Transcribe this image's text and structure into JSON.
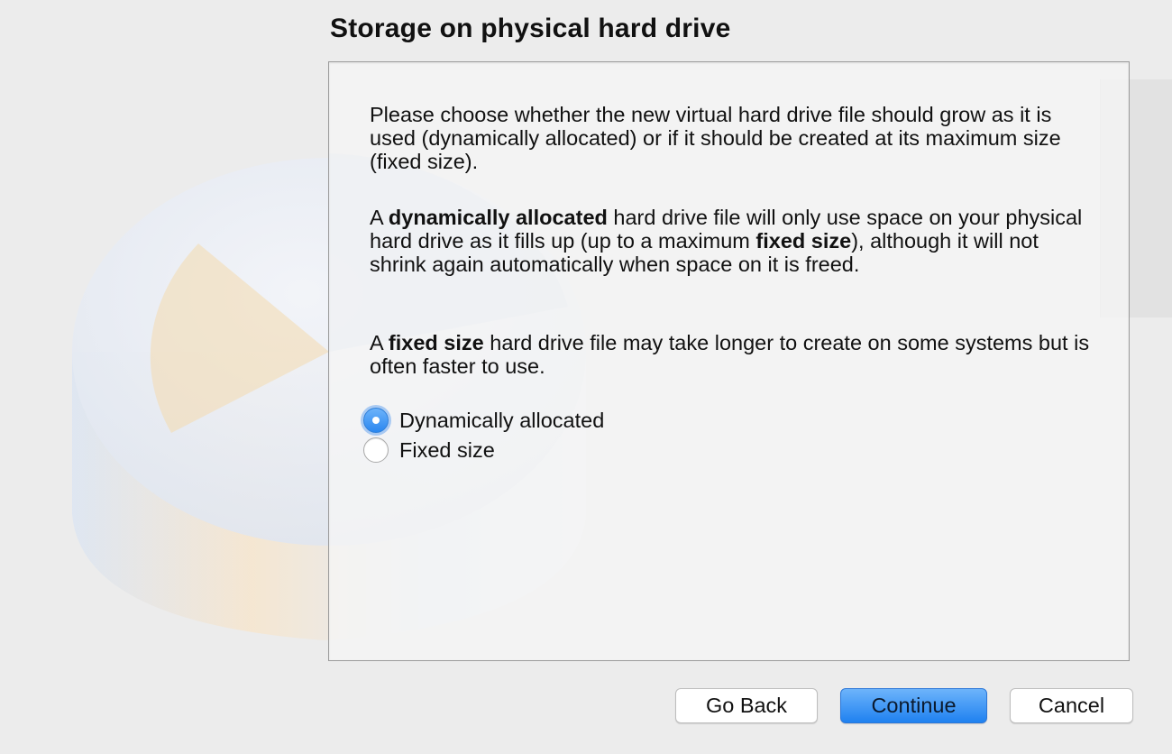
{
  "dialog": {
    "title": "Storage on physical hard drive"
  },
  "description": {
    "para1": "Please choose whether the new virtual hard drive file should grow as it is used (dynamically allocated) or if it should be created at its maximum size (fixed size).",
    "para2": {
      "t1": "A ",
      "b1": "dynamically allocated",
      "t2": " hard drive file will only use space on your physical hard drive as it fills up (up to a maximum ",
      "b2": "fixed size",
      "t3": "), although it will not shrink again automatically when space on it is freed."
    },
    "para3": {
      "t1": "A ",
      "b1": "fixed size",
      "t2": " hard drive file may take longer to create on some systems but is often faster to use."
    }
  },
  "options": [
    {
      "label": "Dynamically allocated",
      "selected": true
    },
    {
      "label": "Fixed size",
      "selected": false
    }
  ],
  "buttons": {
    "back": "Go Back",
    "continue": "Continue",
    "cancel": "Cancel"
  },
  "colors": {
    "accent": "#2a87f0",
    "window_bg": "#ececec"
  }
}
